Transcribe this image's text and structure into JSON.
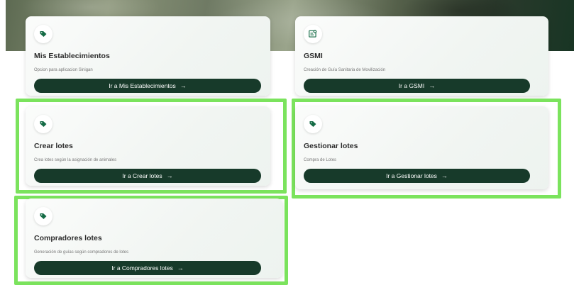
{
  "colors": {
    "button_bg": "#173a2a",
    "icon_green": "#146b45",
    "highlight": "#7be35d"
  },
  "cards": [
    {
      "title": "Mis Establecimientos",
      "description": "Opcion para aplicacion Sinigan",
      "button_label": "Ir a Mis Establecimientos",
      "icon": "tag-icon"
    },
    {
      "title": "GSMI",
      "description": "Creación de Guía Sanitaria de Movilización",
      "button_label": "Ir a GSMI",
      "icon": "document-badge-icon"
    },
    {
      "title": "Crear lotes",
      "description": "Crea lotes según la asignación de animales",
      "button_label": "Ir a Crear lotes",
      "icon": "tag-icon"
    },
    {
      "title": "Gestionar lotes",
      "description": "Compra de Lotes",
      "button_label": "Ir a Gestionar lotes",
      "icon": "tag-icon"
    },
    {
      "title": "Compradores lotes",
      "description": "Generación de guías según compradores de lotes",
      "button_label": "Ir a Compradores lotes",
      "icon": "tag-icon"
    }
  ],
  "arrow": "→"
}
